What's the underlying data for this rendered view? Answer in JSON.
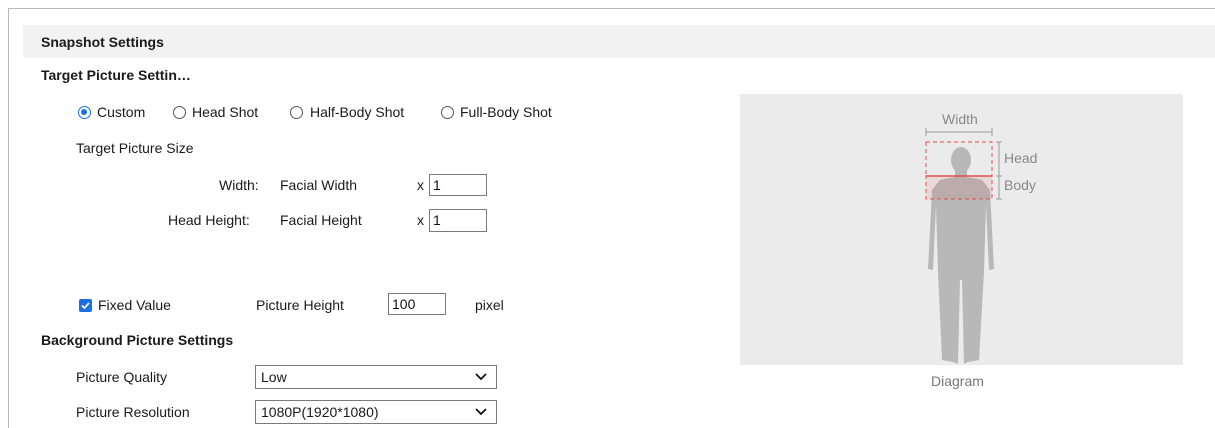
{
  "header": {
    "title": "Snapshot Settings"
  },
  "target_section": {
    "title": "Target Picture Settin…"
  },
  "shot_options": [
    {
      "label": "Custom",
      "selected": true
    },
    {
      "label": "Head Shot",
      "selected": false
    },
    {
      "label": "Half-Body Shot",
      "selected": false
    },
    {
      "label": "Full-Body Shot",
      "selected": false
    }
  ],
  "target_size": {
    "label": "Target Picture Size",
    "width_label": "Width:",
    "width_ref": "Facial Width",
    "width_mult": "x",
    "width_value": "1",
    "height_label": "Head Height:",
    "height_ref": "Facial Height",
    "height_mult": "x",
    "height_value": "1"
  },
  "fixed": {
    "label": "Fixed Value",
    "checked": true,
    "picture_height_label": "Picture Height",
    "picture_height_value": "100",
    "unit": "pixel"
  },
  "background_section": {
    "title": "Background Picture Settings"
  },
  "picture_quality": {
    "label": "Picture Quality",
    "value": "Low"
  },
  "picture_resolution": {
    "label": "Picture Resolution",
    "value": "1080P(1920*1080)"
  },
  "diagram": {
    "caption": "Diagram",
    "width_label": "Width",
    "head_label": "Head",
    "body_label": "Body"
  },
  "colors": {
    "accent": "#1a6fe6",
    "header_bg": "#f2f2f2",
    "diagram_bg": "#ebebeb",
    "guide_red": "#e05050"
  }
}
